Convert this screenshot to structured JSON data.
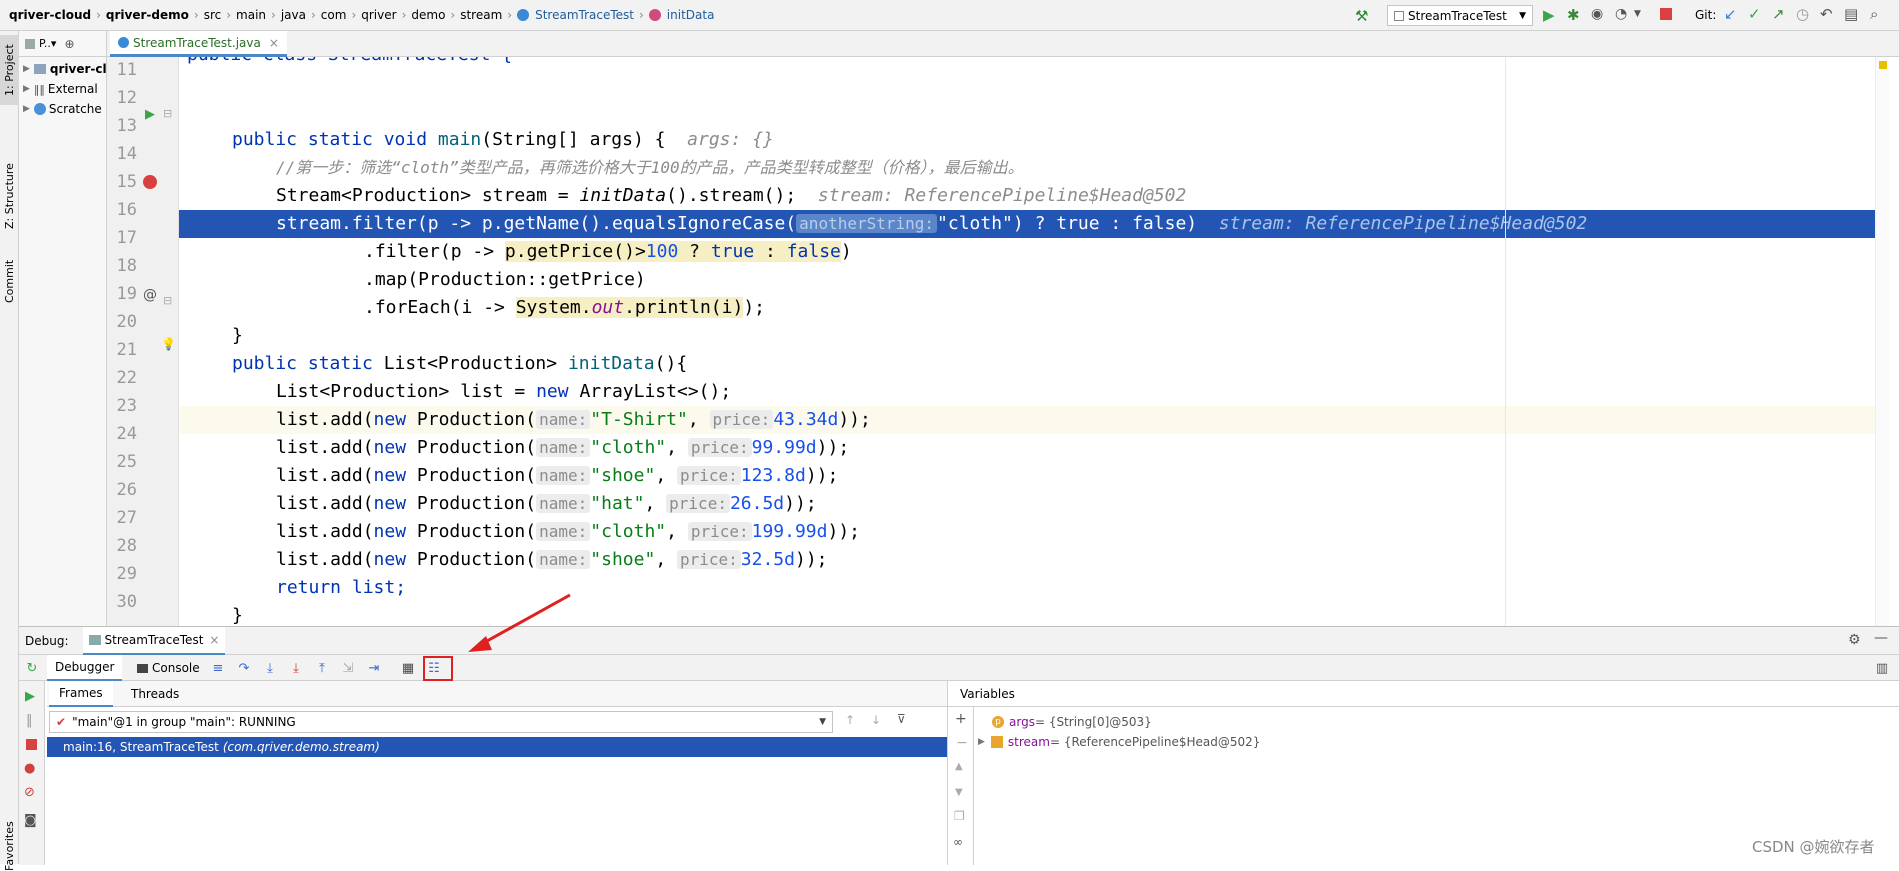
{
  "breadcrumb": [
    "qriver-cloud",
    "qriver-demo",
    "src",
    "main",
    "java",
    "com",
    "qriver",
    "demo",
    "stream",
    "StreamTraceTest",
    "initData"
  ],
  "run_config": "StreamTraceTest",
  "git_label": "Git:",
  "left_tabs": [
    "1: Project",
    "Z: Structure",
    "Commit",
    "Favorites"
  ],
  "project_panel": {
    "title": "P..▾",
    "items": [
      "qriver-cl",
      "External",
      "Scratche"
    ]
  },
  "editor_tab": "StreamTraceTest.java",
  "code_lines": [
    {
      "n": "11"
    },
    {
      "n": "12"
    },
    {
      "n": "13"
    },
    {
      "n": "14"
    },
    {
      "n": "15"
    },
    {
      "n": "16"
    },
    {
      "n": "17"
    },
    {
      "n": "18"
    },
    {
      "n": "19"
    },
    {
      "n": "20"
    },
    {
      "n": "21"
    },
    {
      "n": "22"
    },
    {
      "n": "23"
    },
    {
      "n": "24"
    },
    {
      "n": "25"
    },
    {
      "n": "26"
    },
    {
      "n": "27"
    },
    {
      "n": "28"
    },
    {
      "n": "29"
    },
    {
      "n": "30"
    }
  ],
  "code_top": "public class StreamTraceTest {",
  "code": {
    "l13": {
      "a": "public static void ",
      "b": "main",
      "c": "(String[] args) {  ",
      "hint": "args: {}"
    },
    "l14": "//第一步：筛选“cloth”类型产品，再筛选价格大于100的产品，产品类型转成整型（价格），最后输出。",
    "l15": {
      "a": "Stream<Production> stream = ",
      "b": "initData",
      "c": "().stream();  ",
      "hint": "stream: ReferencePipeline$Head@502"
    },
    "l16": {
      "a": "stream.filter(p -> p.getName().equalsIgnoreCase(",
      "p": "anotherString:",
      "s": "\"cloth\"",
      "c": ") ? true : false)  ",
      "hint": "stream: ReferencePipeline$Head@502"
    },
    "l17": {
      "a": ".filter(p -> ",
      "y": "p.getPrice()",
      "b": ">",
      "n": "100",
      "c": " ? true : false)"
    },
    "l18": ".map(Production::getPrice)",
    "l19": {
      "a": ".forEach(i -> ",
      "y1": "System.",
      "y2": "out",
      "y3": ".println(i)",
      "c": ");"
    },
    "l20": "}",
    "l21": {
      "a": "public static ",
      "b": "List<Production> ",
      "c": "initData",
      "d": "(){"
    },
    "l22": {
      "a": "List<Production> list = ",
      "b": "new",
      "c": " ArrayList<>();"
    },
    "rows": [
      {
        "name": "\"T-Shirt\"",
        "price": "43.34d"
      },
      {
        "name": "\"cloth\"",
        "price": "99.99d"
      },
      {
        "name": "\"shoe\"",
        "price": "123.8d"
      },
      {
        "name": "\"hat\"",
        "price": "26.5d"
      },
      {
        "name": "\"cloth\"",
        "price": "199.99d"
      },
      {
        "name": "\"shoe\"",
        "price": "32.5d"
      }
    ],
    "pname": "name:",
    "pprice": "price:",
    "l29": "return list;",
    "l30": "}"
  },
  "debug": {
    "label": "Debug:",
    "session": "StreamTraceTest",
    "tabs": [
      "Debugger",
      "Console"
    ],
    "frames_tabs": [
      "Frames",
      "Threads"
    ],
    "thread": "\"main\"@1 in group \"main\": RUNNING",
    "frame": "main:16, StreamTraceTest",
    "frame_pkg": "(com.qriver.demo.stream)",
    "variables_title": "Variables",
    "vars": [
      {
        "name": "args",
        "value": " = {String[0]@503}"
      },
      {
        "name": "stream",
        "value": " = {ReferencePipeline$Head@502}"
      }
    ]
  },
  "watermark": "CSDN @婉欲存者",
  "colors": {
    "selection": "#2355b5",
    "accent": "#4a88c7",
    "annotation": "#e02020"
  }
}
